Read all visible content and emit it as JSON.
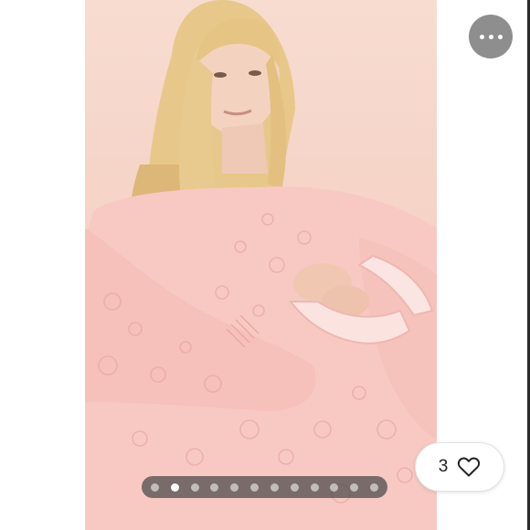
{
  "listing": {
    "photo_alt": "",
    "background_color": "#f5d2c6"
  },
  "more_menu": {
    "icon": "more-horizontal-icon"
  },
  "like": {
    "count": "3",
    "icon": "heart-outline-icon"
  },
  "carousel": {
    "total_images": 12,
    "active_index": 1
  }
}
